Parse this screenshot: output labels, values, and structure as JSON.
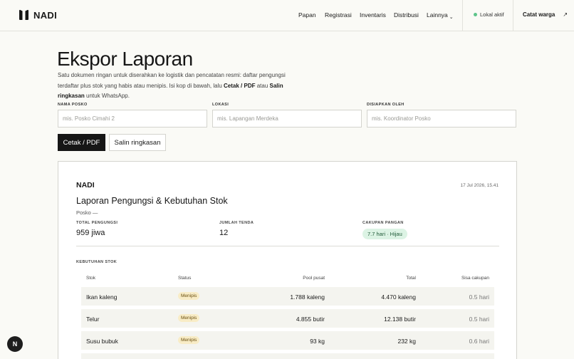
{
  "nav": {
    "brand": "NADI",
    "links": [
      "Papan",
      "Registrasi",
      "Inventaris",
      "Distribusi",
      "Lainnya"
    ],
    "status": "Lokal aktif",
    "cta": "Catat warga"
  },
  "page": {
    "title": "Ekspor Laporan",
    "desc_1": "Satu dokumen ringan untuk diserahkan ke logistik dan pencatatan resmi: daftar pengungsi terdaftar plus stok yang habis atau menipis. Isi kop di bawah, lalu ",
    "desc_b1": "Cetak / PDF",
    "desc_2": " atau ",
    "desc_b2": "Salin ringkasan",
    "desc_3": " untuk WhatsApp."
  },
  "form": {
    "posko_label": "NAMA POSKO",
    "posko_placeholder": "mis. Posko Cimahi 2",
    "lokasi_label": "LOKASI",
    "lokasi_placeholder": "mis. Lapangan Merdeka",
    "oleh_label": "DISIAPKAN OLEH",
    "oleh_placeholder": "mis. Koordinator Posko",
    "print_btn": "Cetak / PDF",
    "copy_btn": "Salin ringkasan"
  },
  "report": {
    "brand": "NADI",
    "date": "17 Jul 2026, 15.41",
    "title": "Laporan Pengungsi & Kebutuhan Stok",
    "posko": "Posko —",
    "stats": {
      "pengungsi_label": "TOTAL PENGUNGSI",
      "pengungsi_value": "959 jiwa",
      "tenda_label": "JUMLAH TENDA",
      "tenda_value": "12",
      "pangan_label": "CAKUPAN PANGAN",
      "pangan_value": "7.7 hari · Hijau"
    },
    "stock_label": "KEBUTUHAN STOK",
    "columns": [
      "Stok",
      "Status",
      "Pool pusat",
      "Total",
      "Sisa cakupan"
    ],
    "rows": [
      {
        "stok": "Ikan kaleng",
        "status": "Menipis",
        "pool": "1.788 kaleng",
        "total": "4.470 kaleng",
        "sisa": "0.5 hari"
      },
      {
        "stok": "Telur",
        "status": "Menipis",
        "pool": "4.855 butir",
        "total": "12.138 butir",
        "sisa": "0.5 hari"
      },
      {
        "stok": "Susu bubuk",
        "status": "Menipis",
        "pool": "93 kg",
        "total": "232 kg",
        "sisa": "0.6 hari"
      }
    ]
  },
  "colors": {
    "accent": "#161616",
    "pill_bg": "#dcf3e4",
    "badge_bg": "#f8ecc6",
    "status_dot": "#5dc48a"
  },
  "fab": "N"
}
